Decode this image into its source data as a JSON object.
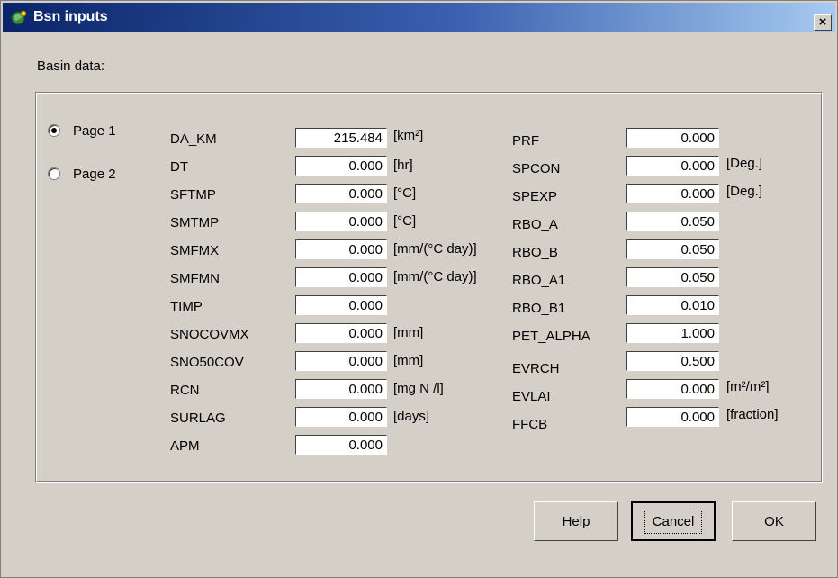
{
  "window": {
    "title": "Bsn inputs",
    "close_glyph": "×"
  },
  "basin_label": "Basin data:",
  "pages": [
    {
      "label": "Page 1",
      "selected": true
    },
    {
      "label": "Page 2",
      "selected": false
    }
  ],
  "left_params": [
    {
      "name": "DA_KM",
      "value": "215.484",
      "unit": "[km²]"
    },
    {
      "name": "DT",
      "value": "0.000",
      "unit": "[hr]"
    },
    {
      "name": "SFTMP",
      "value": "0.000",
      "unit": "[°C]"
    },
    {
      "name": "SMTMP",
      "value": "0.000",
      "unit": "[°C]"
    },
    {
      "name": "SMFMX",
      "value": "0.000",
      "unit": "[mm/(°C day)]"
    },
    {
      "name": "SMFMN",
      "value": "0.000",
      "unit": "[mm/(°C day)]"
    },
    {
      "name": "TIMP",
      "value": "0.000",
      "unit": ""
    },
    {
      "name": "SNOCOVMX",
      "value": "0.000",
      "unit": "[mm]"
    },
    {
      "name": "SNO50COV",
      "value": "0.000",
      "unit": "[mm]"
    },
    {
      "name": "RCN",
      "value": "0.000",
      "unit": "[mg N /l]"
    },
    {
      "name": "SURLAG",
      "value": "0.000",
      "unit": "[days]"
    },
    {
      "name": "APM",
      "value": "0.000",
      "unit": ""
    }
  ],
  "right_params": [
    {
      "name": "PRF",
      "value": "0.000",
      "unit": ""
    },
    {
      "name": "SPCON",
      "value": "0.000",
      "unit": "[Deg.]"
    },
    {
      "name": "SPEXP",
      "value": "0.000",
      "unit": "[Deg.]"
    },
    {
      "name": "RBO_A",
      "value": "0.050",
      "unit": ""
    },
    {
      "name": "RBO_B",
      "value": "0.050",
      "unit": ""
    },
    {
      "name": "RBO_A1",
      "value": "0.050",
      "unit": ""
    },
    {
      "name": "RBO_B1",
      "value": "0.010",
      "unit": ""
    },
    {
      "name": "PET_ALPHA",
      "value": "1.000",
      "unit": ""
    },
    {
      "name": "EVRCH",
      "value": "0.500",
      "unit": ""
    },
    {
      "name": "EVLAI",
      "value": "0.000",
      "unit": "[m²/m²]"
    },
    {
      "name": "FFCB",
      "value": "0.000",
      "unit": "[fraction]"
    }
  ],
  "buttons": {
    "help": "Help",
    "cancel": "Cancel",
    "ok": "OK"
  },
  "colors": {
    "window_face": "#d4d0c8",
    "title_start": "#0a246a",
    "title_end": "#a6caf0"
  }
}
